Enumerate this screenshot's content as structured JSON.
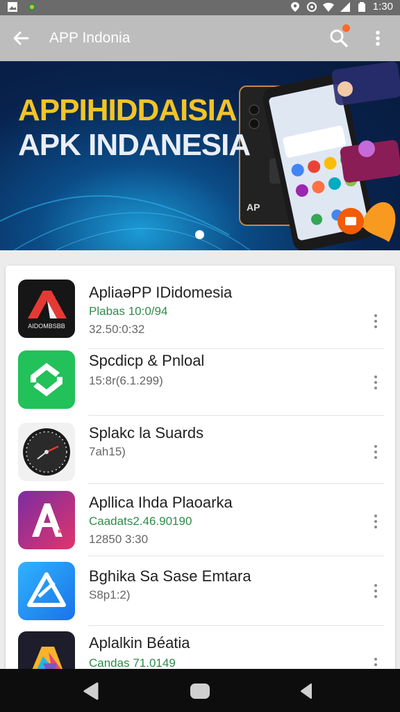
{
  "status_bar": {
    "time": "1:30",
    "icons": [
      "image-icon",
      "app-notification-icon",
      "location-icon",
      "data-saver-icon",
      "wifi-icon",
      "signal-icon",
      "battery-icon"
    ]
  },
  "app_bar": {
    "title": "APP Indonia",
    "icons": [
      "back-arrow-icon",
      "search-icon",
      "more-vert-icon"
    ],
    "badge_color": "#ff6a2b"
  },
  "banner": {
    "headline_1": "APPIHIDDAISIA",
    "headline_2": "APK INDANESIA",
    "phone_label": "AP",
    "headline_1_color": "#f3c327",
    "headline_2_color": "#e9eef7"
  },
  "apps": [
    {
      "name": "ApliaəPP IDidomesia",
      "line1": "Plabas 10:0/94",
      "line2": "32.50:0:32",
      "icon_text": "AIDOMBSBB",
      "icon": "red-a-logo-icon"
    },
    {
      "name": "Spcdicp & Pnloal",
      "line1": "15:8r(6.1.299)",
      "line2": "",
      "icon": "green-sync-icon"
    },
    {
      "name": "Splakc la Suards",
      "line1": "7ah15)",
      "line2": "",
      "icon": "clock-icon"
    },
    {
      "name": "Apllica Ihda Plaoarka",
      "line1": "Caadats2.46.90190",
      "line2": "12850 3:30",
      "icon": "pink-a-icon"
    },
    {
      "name": "Bghika Sa Sase Emtara",
      "line1": "S8p1:2)",
      "line2": "",
      "icon": "blue-triangle-icon"
    },
    {
      "name": "Aplalkin Béatia",
      "line1": "Candas 71.0149",
      "line2": "",
      "icon": "colorful-logo-icon"
    }
  ],
  "nav_bar": {
    "icons": [
      "back-triangle-icon",
      "home-icon",
      "recents-icon"
    ]
  },
  "colors": {
    "app_bar": "#bdbdbd",
    "status_bar": "#6b6b6b",
    "green_text": "#2e8b4a"
  }
}
